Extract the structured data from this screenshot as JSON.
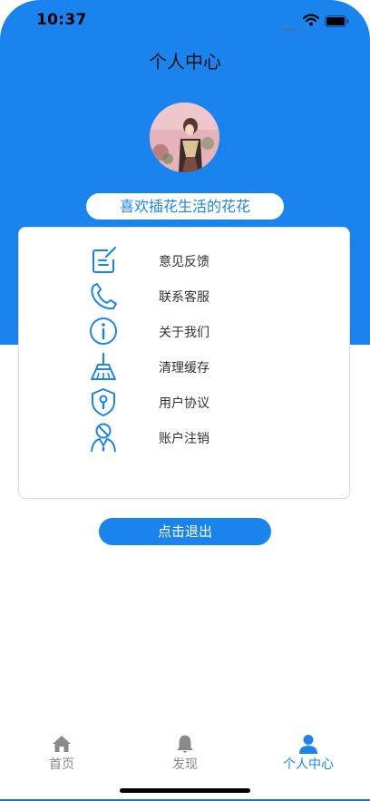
{
  "status_bar": {
    "time": "10:37"
  },
  "header": {
    "title": "个人中心"
  },
  "profile": {
    "username": "喜欢插花生活的花花"
  },
  "menu": {
    "items": [
      {
        "label": "意见反馈",
        "icon": "edit-note-icon"
      },
      {
        "label": "联系客服",
        "icon": "phone-icon"
      },
      {
        "label": "关于我们",
        "icon": "info-icon"
      },
      {
        "label": "清理缓存",
        "icon": "broom-icon"
      },
      {
        "label": "用户协议",
        "icon": "shield-keyhole-icon"
      },
      {
        "label": "账户注销",
        "icon": "user-cancel-icon"
      }
    ]
  },
  "logout": {
    "label": "点击退出"
  },
  "tab_bar": {
    "tabs": [
      {
        "label": "首页",
        "icon": "home-icon",
        "active": false
      },
      {
        "label": "发现",
        "icon": "bell-icon",
        "active": false
      },
      {
        "label": "个人中心",
        "icon": "person-icon",
        "active": true
      }
    ]
  },
  "colors": {
    "primary": "#1a84ee",
    "text": "#333333",
    "tab_inactive": "#8a8a8a"
  }
}
